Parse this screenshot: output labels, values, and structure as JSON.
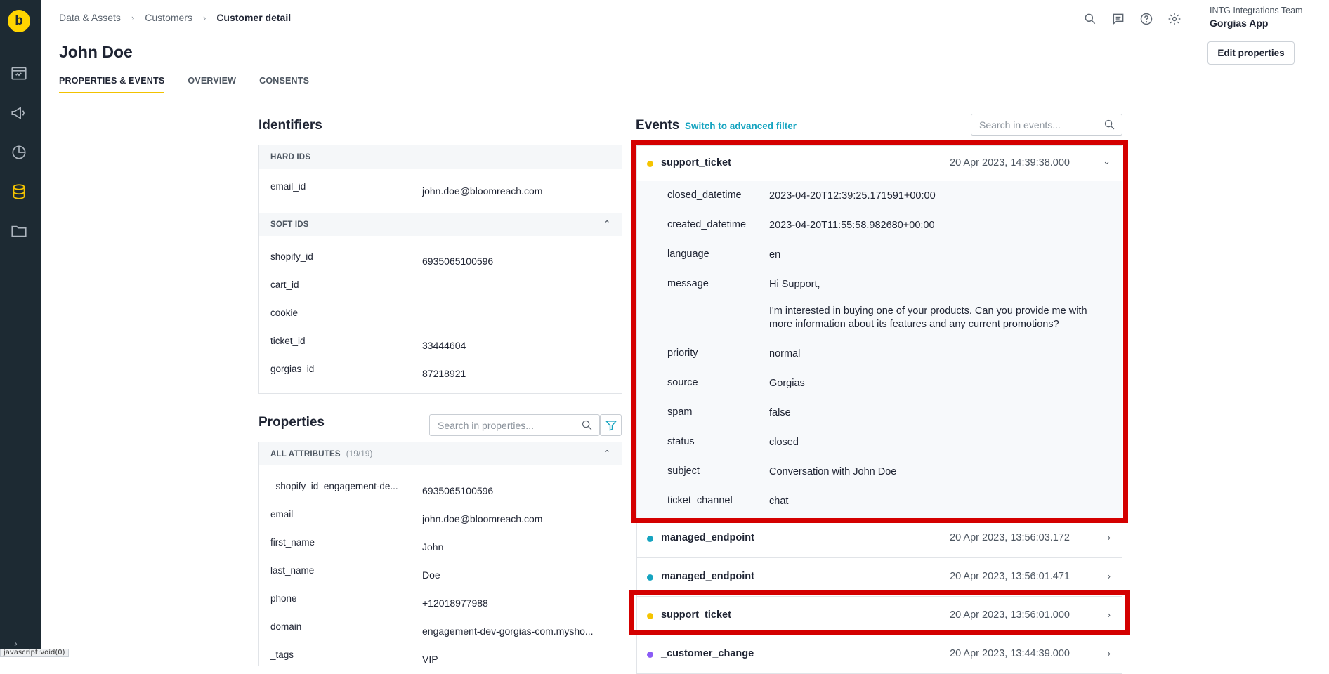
{
  "url_status": "javascript:void(0)",
  "sidebar": {
    "logo_letter": "b",
    "icons": [
      "calendar-icon",
      "megaphone-icon",
      "pie-chart-icon",
      "database-icon",
      "folder-icon"
    ],
    "expand": "›"
  },
  "breadcrumb": [
    {
      "label": "Data & Assets"
    },
    {
      "label": "Customers"
    },
    {
      "label": "Customer detail"
    }
  ],
  "page": {
    "title": "John Doe",
    "tabs": [
      {
        "label": "PROPERTIES & EVENTS",
        "active": true
      },
      {
        "label": "OVERVIEW"
      },
      {
        "label": "CONSENTS"
      }
    ],
    "edit_button": "Edit properties",
    "more": "∘∘∘"
  },
  "org": {
    "team": "INTG Integrations Team",
    "app": "Gorgias App"
  },
  "identifiers": {
    "title": "Identifiers",
    "hard_ids": {
      "label": "HARD IDS",
      "rows": [
        {
          "key": "email_id",
          "value": "john.doe@bloomreach.com"
        }
      ]
    },
    "soft_ids": {
      "label": "SOFT IDS",
      "rows": [
        {
          "key": "shopify_id",
          "value": "6935065100596"
        },
        {
          "key": "cart_id",
          "value": ""
        },
        {
          "key": "cookie",
          "value": ""
        },
        {
          "key": "ticket_id",
          "value": "33444604"
        },
        {
          "key": "gorgias_id",
          "value": "87218921"
        }
      ]
    }
  },
  "properties": {
    "title": "Properties",
    "search_placeholder": "Search in properties...",
    "group_label": "ALL ATTRIBUTES",
    "group_count": "(19/19)",
    "rows": [
      {
        "key": "_shopify_id_engagement-de...",
        "value": "6935065100596"
      },
      {
        "key": "email",
        "value": "john.doe@bloomreach.com"
      },
      {
        "key": "first_name",
        "value": "John"
      },
      {
        "key": "last_name",
        "value": "Doe"
      },
      {
        "key": "phone",
        "value": "+12018977988"
      },
      {
        "key": "domain",
        "value": "engagement-dev-gorgias-com.mysho..."
      },
      {
        "key": "_tags",
        "value": "VIP"
      }
    ]
  },
  "events": {
    "title": "Events",
    "advanced_filter_link": "Switch to advanced filter",
    "search_placeholder": "Search in events...",
    "items": [
      {
        "name": "support_ticket",
        "time": "20 Apr 2023, 14:39:38.000",
        "dot_color": "#f5c400",
        "expanded": true,
        "properties": [
          {
            "key": "closed_datetime",
            "value": "2023-04-20T12:39:25.171591+00:00"
          },
          {
            "key": "created_datetime",
            "value": "2023-04-20T11:55:58.982680+00:00"
          },
          {
            "key": "language",
            "value": "en"
          },
          {
            "key": "message",
            "lines": [
              "Hi Support,",
              "I'm interested in buying one of your products. Can you provide me with more information about its features and any current promotions?"
            ]
          },
          {
            "key": "priority",
            "value": "normal"
          },
          {
            "key": "source",
            "value": "Gorgias"
          },
          {
            "key": "spam",
            "value": "false"
          },
          {
            "key": "status",
            "value": "closed"
          },
          {
            "key": "subject",
            "value": "Conversation with John Doe"
          },
          {
            "key": "ticket_channel",
            "value": "chat"
          }
        ]
      },
      {
        "name": "managed_endpoint",
        "time": "20 Apr 2023, 13:56:03.172",
        "dot_color": "#16a4c0"
      },
      {
        "name": "managed_endpoint",
        "time": "20 Apr 2023, 13:56:01.471",
        "dot_color": "#16a4c0"
      },
      {
        "name": "support_ticket",
        "time": "20 Apr 2023, 13:56:01.000",
        "dot_color": "#f5c400"
      },
      {
        "name": "_customer_change",
        "time": "20 Apr 2023, 13:44:39.000",
        "dot_color": "#8b5cf6"
      }
    ]
  },
  "colors": {
    "sidebar": "#1d2a33",
    "accent": "#f2c200",
    "link": "#16a4c0",
    "highlight": "#d40000"
  }
}
